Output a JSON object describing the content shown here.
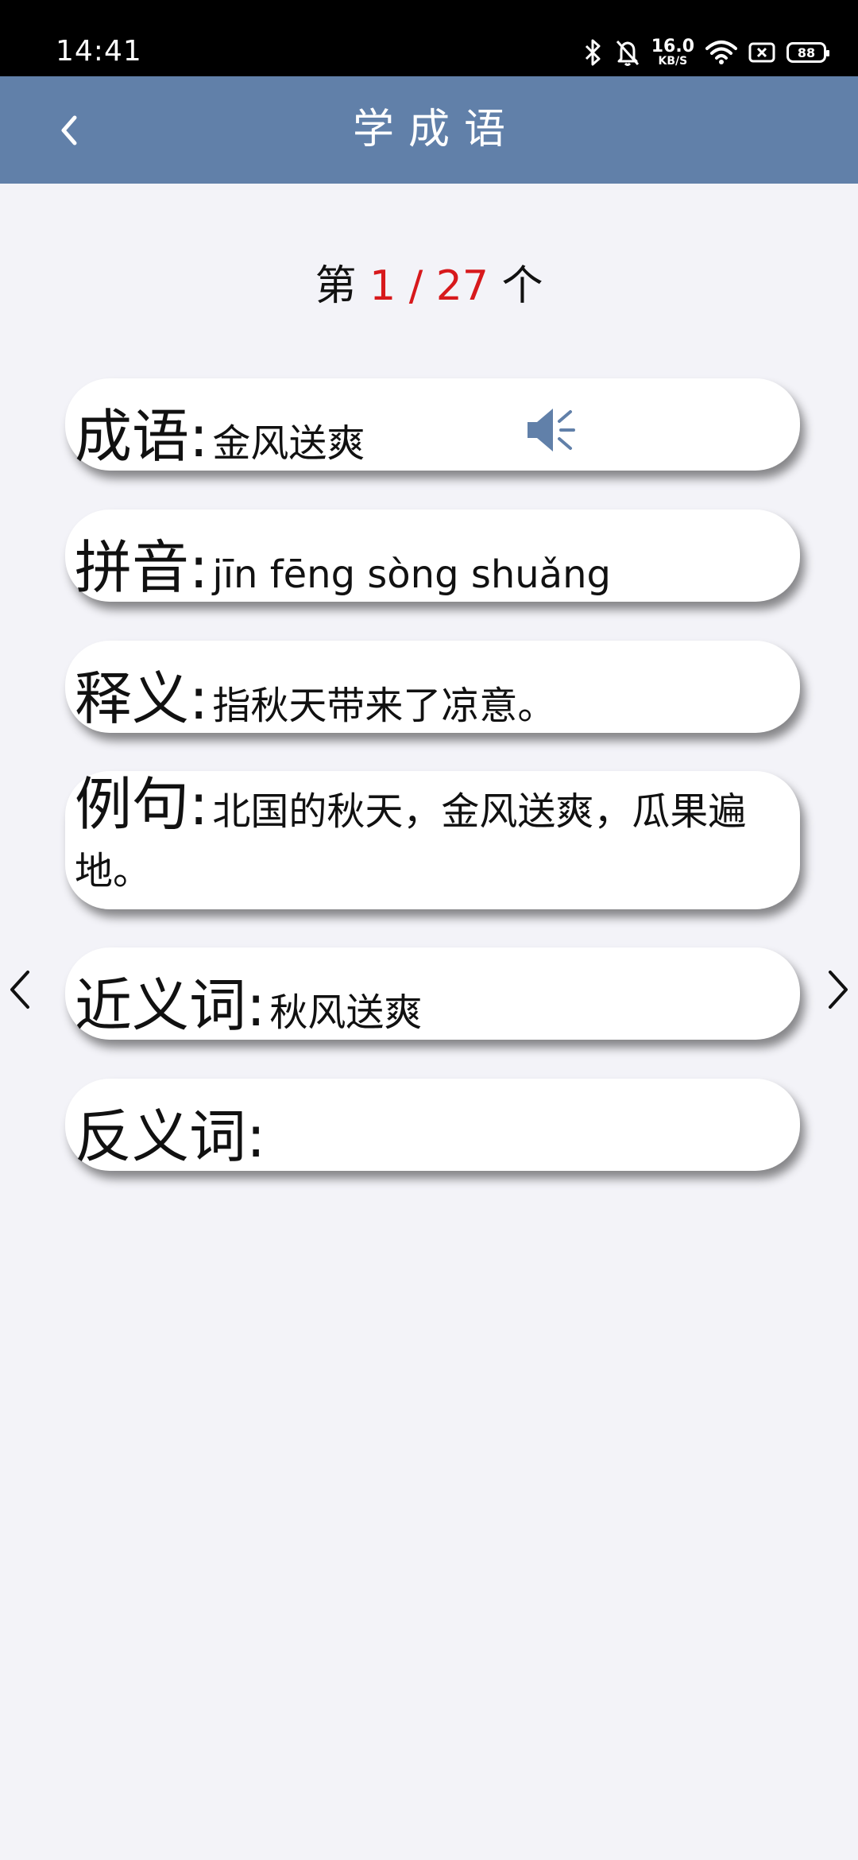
{
  "status_bar": {
    "time": "14:41",
    "net_speed": "16.0",
    "net_speed_unit": "KB/S",
    "battery": "88",
    "icons": [
      "bluetooth-icon",
      "mute-bell-icon",
      "wifi-icon",
      "sim-off-icon",
      "battery-icon"
    ]
  },
  "app_bar": {
    "title": "学成语",
    "back_icon": "chevron-left-icon",
    "color": "#6180a9"
  },
  "counter": {
    "prefix": "第",
    "current": "1",
    "separator": "/",
    "total": "27",
    "suffix": "个",
    "highlight_color": "#d7191c"
  },
  "cards": {
    "idiom": {
      "label": "成语:",
      "value": "金风送爽",
      "speaker_icon": "speaker-icon"
    },
    "pinyin": {
      "label": "拼音:",
      "value": "jīn fēng sòng shuǎng"
    },
    "meaning": {
      "label": "释义:",
      "value": "指秋天带来了凉意。"
    },
    "example": {
      "label": "例句:",
      "value": "北国的秋天，金风送爽，瓜果遍地。"
    },
    "synonym": {
      "label": "近义词:",
      "value": "秋风送爽"
    },
    "antonym": {
      "label": "反义词:",
      "value": ""
    }
  },
  "navigation": {
    "prev_icon": "chevron-left-icon",
    "next_icon": "chevron-right-icon"
  }
}
